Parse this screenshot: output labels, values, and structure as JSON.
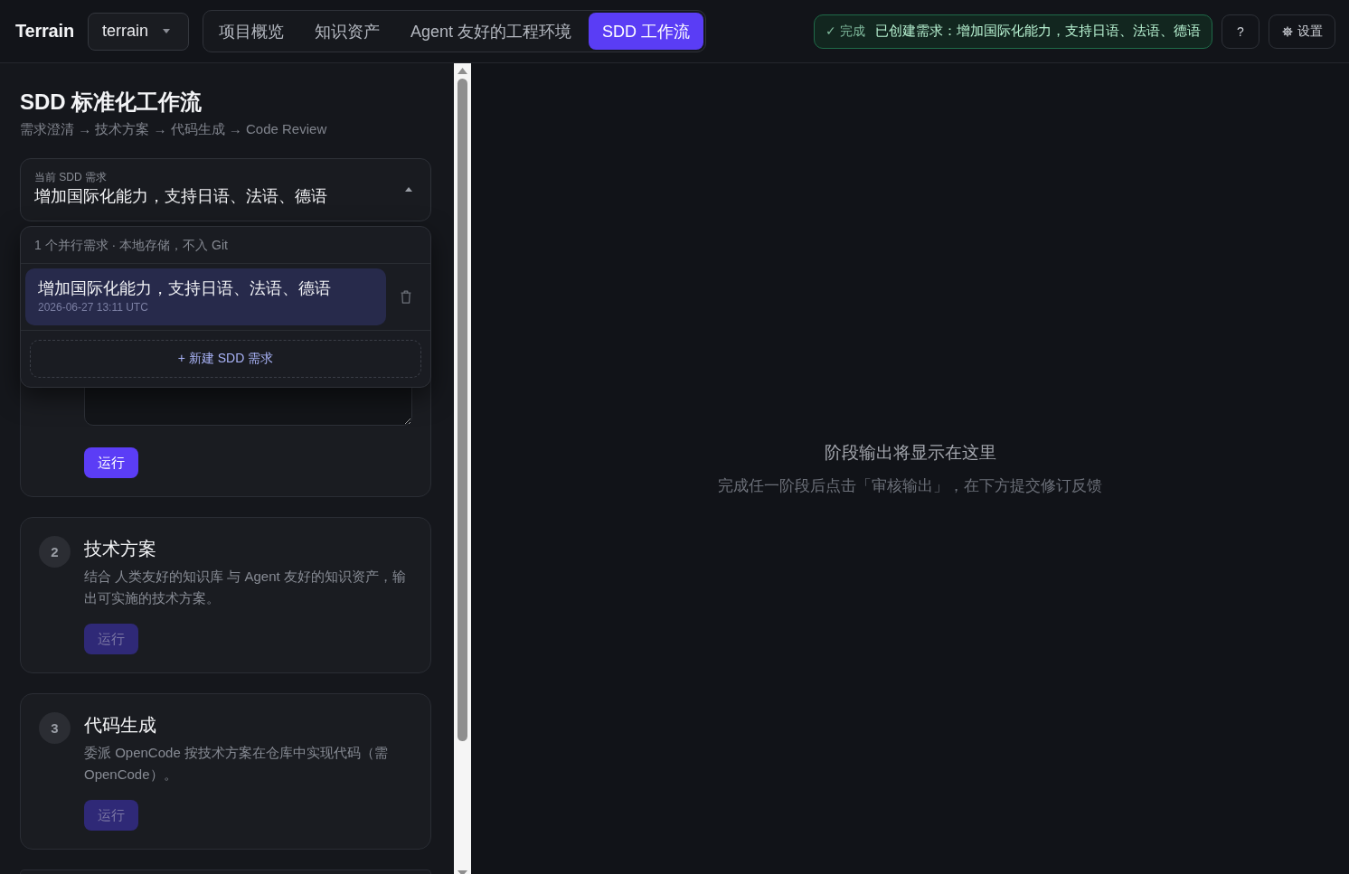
{
  "top_bar": {
    "logo": "Terrain",
    "project_select": {
      "value": "terrain"
    },
    "tabs": [
      {
        "label": "项目概览",
        "selected": false
      },
      {
        "label": "知识资产",
        "selected": false
      },
      {
        "label": "Agent 友好的工程环境",
        "selected": false
      },
      {
        "label": "SDD 工作流",
        "selected": true
      }
    ],
    "notice": {
      "status": "✓ 完成",
      "message": "已创建需求：增加国际化能力，支持日语、法语、德语"
    },
    "help_button": "?",
    "settings_button": "设置"
  },
  "sidebar": {
    "title": "SDD 标准化工作流",
    "subtitle": "需求澄清 → 技术方案 → 代码生成 → Code Review",
    "requirement_selector": {
      "label": "当前 SDD 需求",
      "value": "增加国际化能力，支持日语、法语、德语",
      "expanded": true,
      "menu": {
        "summary": "1 个并行需求 · 本地存储，不入 Git",
        "items": [
          {
            "title": "增加国际化能力，支持日语、法语、德语",
            "time": "2026-06-27 13:11 UTC",
            "selected": true
          }
        ],
        "new_button": "+ 新建 SDD 需求"
      }
    },
    "steps": [
      {
        "kind": "input",
        "run_button": {
          "label": "运行",
          "disabled": false
        }
      },
      {
        "kind": "full",
        "number": "2",
        "title": "技术方案",
        "description": "结合 人类友好的知识库 与 Agent 友好的知识资产，输出可实施的技术方案。",
        "run_button": {
          "label": "运行",
          "disabled": true
        }
      },
      {
        "kind": "full",
        "number": "3",
        "title": "代码生成",
        "description": "委派 OpenCode 按技术方案在仓库中实现代码（需 OpenCode）。",
        "run_button": {
          "label": "运行",
          "disabled": true
        }
      },
      {
        "kind": "edge"
      }
    ]
  },
  "output_panel": {
    "title": "阶段输出将显示在这里",
    "hint": "完成任一阶段后点击「审核输出」，在下方提交修订反馈"
  }
}
